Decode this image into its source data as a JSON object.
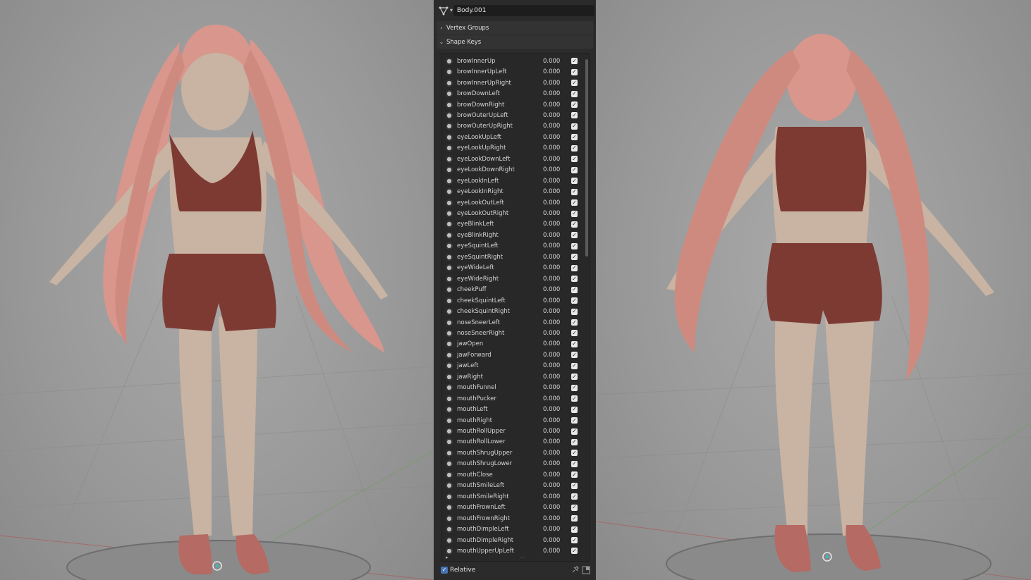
{
  "object_name": "Body.001",
  "sections": {
    "vertex_groups": "Vertex Groups",
    "shape_keys": "Shape Keys"
  },
  "shape_keys": [
    {
      "name": "browInnerUp",
      "value": "0.000"
    },
    {
      "name": "browInnerUpLeft",
      "value": "0.000"
    },
    {
      "name": "browInnerUpRight",
      "value": "0.000"
    },
    {
      "name": "browDownLeft",
      "value": "0.000"
    },
    {
      "name": "browDownRight",
      "value": "0.000"
    },
    {
      "name": "browOuterUpLeft",
      "value": "0.000"
    },
    {
      "name": "browOuterUpRight",
      "value": "0.000"
    },
    {
      "name": "eyeLookUpLeft",
      "value": "0.000"
    },
    {
      "name": "eyeLookUpRight",
      "value": "0.000"
    },
    {
      "name": "eyeLookDownLeft",
      "value": "0.000"
    },
    {
      "name": "eyeLookDownRight",
      "value": "0.000"
    },
    {
      "name": "eyeLookInLeft",
      "value": "0.000"
    },
    {
      "name": "eyeLookInRight",
      "value": "0.000"
    },
    {
      "name": "eyeLookOutLeft",
      "value": "0.000"
    },
    {
      "name": "eyeLookOutRight",
      "value": "0.000"
    },
    {
      "name": "eyeBlinkLeft",
      "value": "0.000"
    },
    {
      "name": "eyeBlinkRight",
      "value": "0.000"
    },
    {
      "name": "eyeSquintLeft",
      "value": "0.000"
    },
    {
      "name": "eyeSquintRight",
      "value": "0.000"
    },
    {
      "name": "eyeWideLeft",
      "value": "0.000"
    },
    {
      "name": "eyeWideRight",
      "value": "0.000"
    },
    {
      "name": "cheekPuff",
      "value": "0.000"
    },
    {
      "name": "cheekSquintLeft",
      "value": "0.000"
    },
    {
      "name": "cheekSquintRight",
      "value": "0.000"
    },
    {
      "name": "noseSneerLeft",
      "value": "0.000"
    },
    {
      "name": "noseSneerRight",
      "value": "0.000"
    },
    {
      "name": "jawOpen",
      "value": "0.000"
    },
    {
      "name": "jawForward",
      "value": "0.000"
    },
    {
      "name": "jawLeft",
      "value": "0.000"
    },
    {
      "name": "jawRight",
      "value": "0.000"
    },
    {
      "name": "mouthFunnel",
      "value": "0.000"
    },
    {
      "name": "mouthPucker",
      "value": "0.000"
    },
    {
      "name": "mouthLeft",
      "value": "0.000"
    },
    {
      "name": "mouthRight",
      "value": "0.000"
    },
    {
      "name": "mouthRollUpper",
      "value": "0.000"
    },
    {
      "name": "mouthRollLower",
      "value": "0.000"
    },
    {
      "name": "mouthShrugUpper",
      "value": "0.000"
    },
    {
      "name": "mouthShrugLower",
      "value": "0.000"
    },
    {
      "name": "mouthClose",
      "value": "0.000"
    },
    {
      "name": "mouthSmileLeft",
      "value": "0.000"
    },
    {
      "name": "mouthSmileRight",
      "value": "0.000"
    },
    {
      "name": "mouthFrownLeft",
      "value": "0.000"
    },
    {
      "name": "mouthFrownRight",
      "value": "0.000"
    },
    {
      "name": "mouthDimpleLeft",
      "value": "0.000"
    },
    {
      "name": "mouthDimpleRight",
      "value": "0.000"
    },
    {
      "name": "mouthUpperUpLeft",
      "value": "0.000"
    }
  ],
  "relative_label": "Relative",
  "icons": {
    "mesh": "mesh-data-icon",
    "shape_key": "shape-key-icon",
    "pin": "pin-icon",
    "lock": "lock-icon"
  },
  "colors": {
    "panel_bg": "#2b2b2b",
    "viewport_bg": "#9a9a9a",
    "skin": "#c9b3a2",
    "hair": "#d9968d",
    "clothing": "#7d3a33",
    "accent": "#4772b3"
  }
}
